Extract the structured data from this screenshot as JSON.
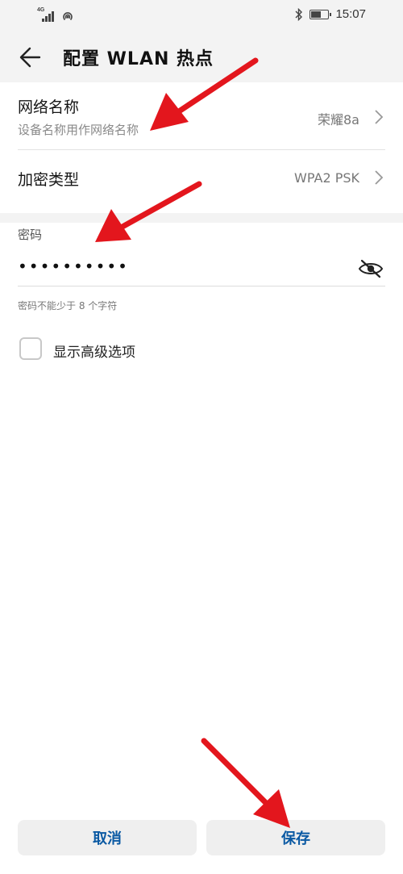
{
  "status_bar": {
    "network_label": "4G",
    "time": "15:07",
    "battery_level": 0.6
  },
  "header": {
    "title": "配置 WLAN 热点"
  },
  "network_name": {
    "label": "网络名称",
    "sublabel": "设备名称用作网络名称",
    "value": "荣耀8a"
  },
  "encryption": {
    "label": "加密类型",
    "value": "WPA2 PSK"
  },
  "password": {
    "label": "密码",
    "masked_value": "••••••••••",
    "hint": "密码不能少于 8 个字符"
  },
  "advanced": {
    "label": "显示高级选项",
    "checked": false
  },
  "buttons": {
    "cancel": "取消",
    "save": "保存"
  },
  "icons": {
    "back": "arrow-left-icon",
    "chevron": "chevron-right-icon",
    "eye": "eye-off-icon",
    "bluetooth": "bluetooth-icon",
    "hotspot": "hotspot-icon",
    "battery": "battery-icon",
    "signal": "signal-icon"
  },
  "colors": {
    "button_text": "#0a59a3",
    "annotation_arrow": "#e3161d"
  }
}
